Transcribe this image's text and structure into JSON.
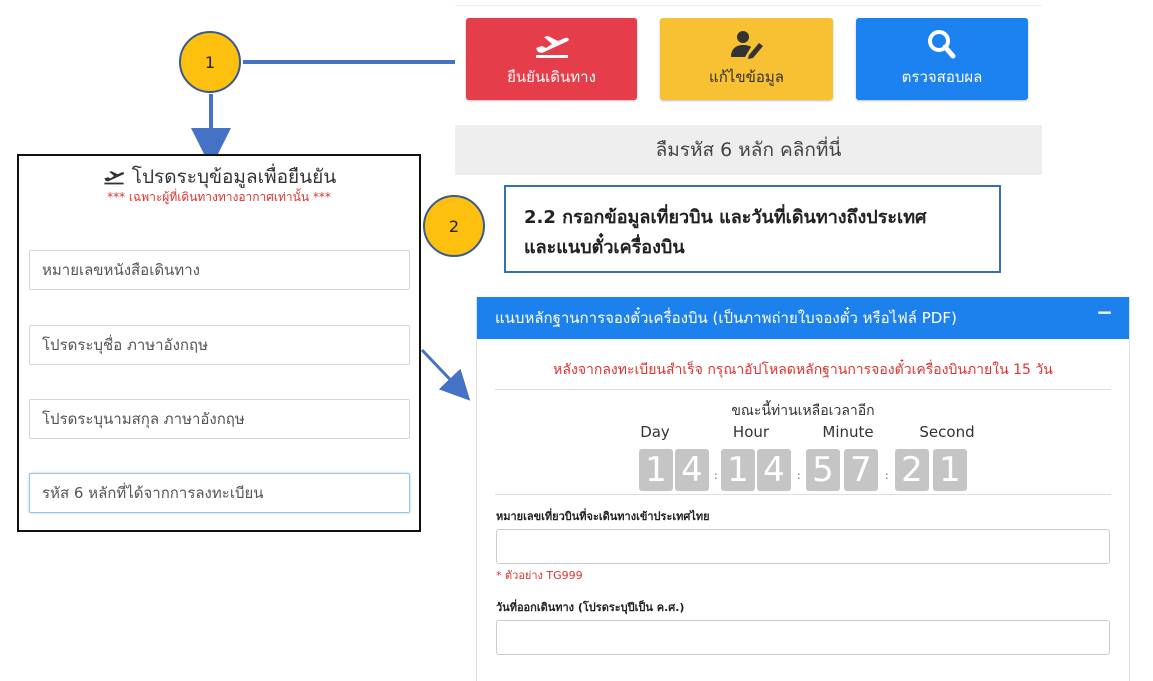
{
  "nav": {
    "confirm_label": "ยืนยันเดินทาง",
    "edit_label": "แก้ไขข้อมูล",
    "check_label": "ตรวจสอบผล"
  },
  "forgot_code": "ลืมรหัส 6 หลัก คลิกที่นี่",
  "callouts": {
    "step1": "1",
    "step2": "2",
    "step2_text_line1": "2.2 กรอกข้อมูลเที่ยวบิน และวันที่เดินทางถึงประเทศ",
    "step2_text_line2": "และแนบตั๋วเครื่องบิน"
  },
  "left_form": {
    "title": "โปรดระบุข้อมูลเพื่อยืนยัน",
    "subtitle": "*** เฉพาะผู้ที่เดินทางทางอากาศเท่านั้น ***",
    "passport_placeholder": "หมายเลขหนังสือเดินทาง",
    "firstname_placeholder": "โปรดระบุชื่อ ภาษาอังกฤษ",
    "lastname_placeholder": "โปรดระบุนามสกุล ภาษาอังกฤษ",
    "code_placeholder": "รหัส 6 หลักที่ได้จากการลงทะเบียน"
  },
  "upload_panel": {
    "header": "แนบหลักฐานการจองตั๋วเครื่องบิน (เป็นภาพถ่ายใบจองตั๋ว หรือไฟล์ PDF)",
    "collapse": "−",
    "notice": "หลังจากลงทะเบียนสำเร็จ กรุณาอัปโหลดหลักฐานการจองตั๋วเครื่องบินภายใน 15 วัน",
    "remaining": "ขณะนี้ท่านเหลือเวลาอีก",
    "countdown_labels": {
      "day": "Day",
      "hour": "Hour",
      "minute": "Minute",
      "second": "Second"
    },
    "countdown_digits": {
      "d1": "1",
      "d2": "4",
      "h1": "1",
      "h2": "4",
      "m1": "5",
      "m2": "7",
      "s1": "2",
      "s2": "1"
    },
    "separator": ":",
    "flight_label": "หมายเลขเที่ยวบินที่จะเดินทางเข้าประเทศไทย",
    "flight_hint": "* ตัวอย่าง TG999",
    "date_label": "วันที่ออกเดินทาง (โปรดระบุปีเป็น ค.ศ.)"
  },
  "colors": {
    "red_button": "#e63d4a",
    "yellow_button": "#f7c133",
    "blue_button": "#1b82f0",
    "panel_header": "#1c81ed",
    "callout_circle": "#fdc00f",
    "arrow": "#4472c4",
    "notice_red": "#e0332f"
  },
  "icons": {
    "confirm": "airplane-departure-icon",
    "edit": "user-edit-icon",
    "check": "search-icon",
    "form_title": "airplane-departure-icon"
  }
}
